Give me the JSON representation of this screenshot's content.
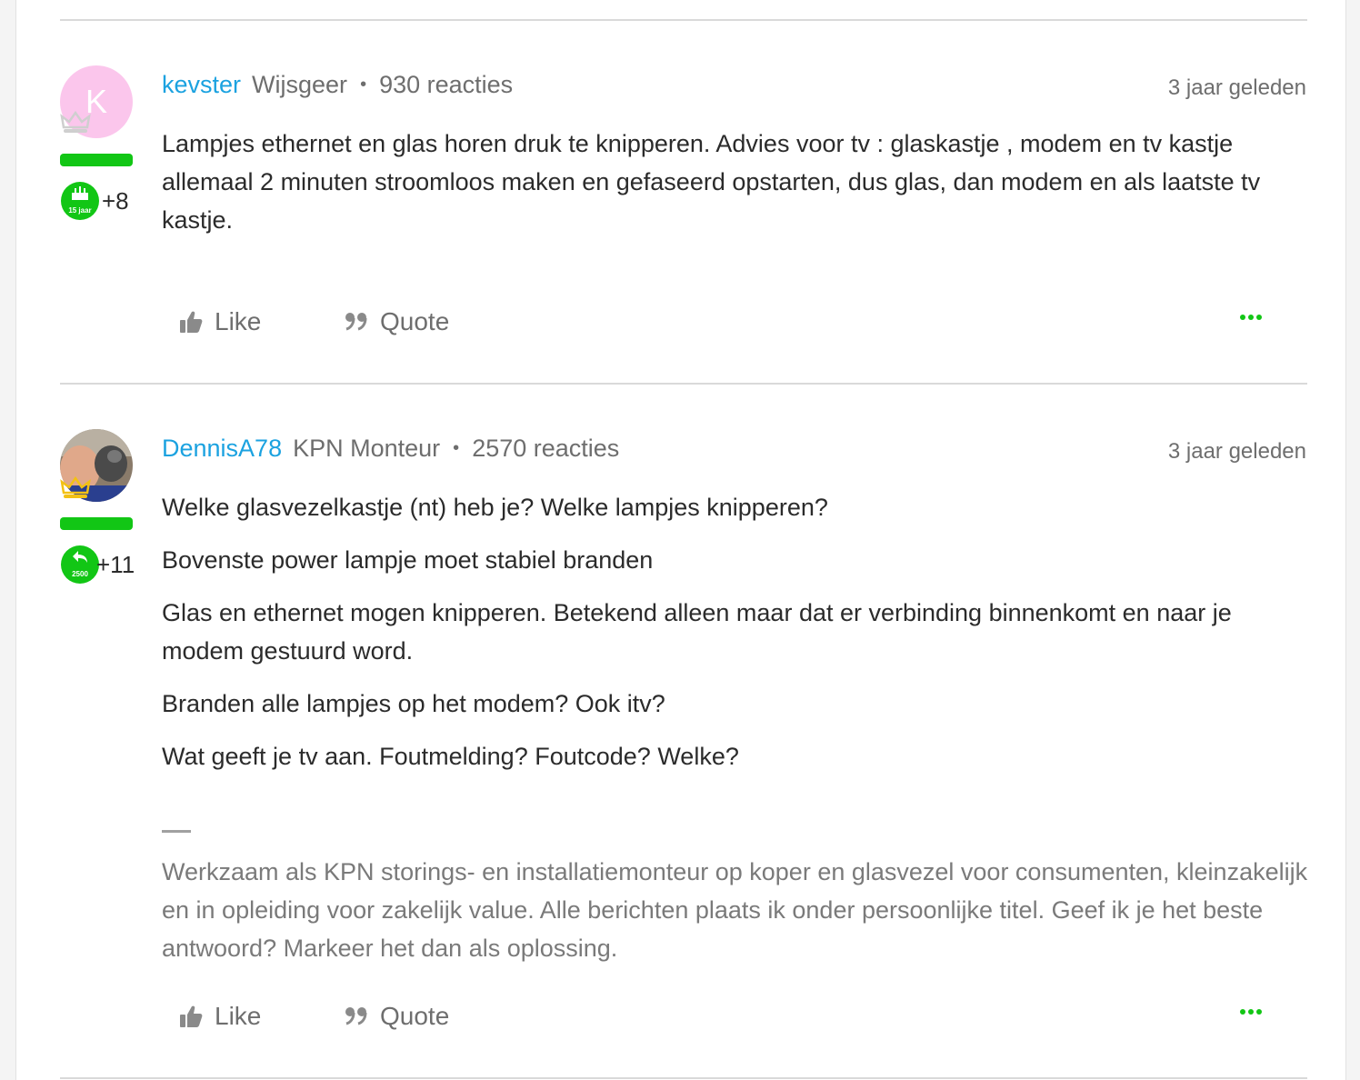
{
  "posts": [
    {
      "avatar_initial": "K",
      "username": "kevster",
      "role": "Wijsgeer",
      "separator": "•",
      "reactions": "930 reacties",
      "timestamp": "3 jaar geleden",
      "badge_text": "15 jaar",
      "badge_count": "+8",
      "body": [
        "Lampjes ethernet en glas horen druk te knipperen. Advies voor tv : glaskastje , modem en tv kastje allemaal 2 minuten stroomloos maken en gefaseerd opstarten,  dus glas, dan modem en als laatste tv kastje."
      ],
      "like_label": "Like",
      "quote_label": "Quote"
    },
    {
      "username": "DennisA78",
      "role": "KPN Monteur",
      "separator": "•",
      "reactions": "2570 reacties",
      "timestamp": "3 jaar geleden",
      "badge_text": "2500",
      "badge_count": "+11",
      "body": [
        "Welke glasvezelkastje (nt) heb je? Welke lampjes knipperen?",
        "Bovenste power lampje moet stabiel branden",
        "Glas en ethernet mogen knipperen. Betekend alleen maar dat er verbinding binnenkomt en naar je modem gestuurd word.",
        "Branden alle lampjes op het modem? Ook itv?",
        "Wat geeft je tv aan. Foutmelding? Foutcode? Welke?"
      ],
      "signature": "Werkzaam als KPN storings- en installatiemonteur op koper en glasvezel voor consumenten, kleinzakelijk en in opleiding voor zakelijk value. Alle berichten plaats ik onder persoonlijke titel. Geef ik je het beste antwoord? Markeer het dan als oplossing.",
      "like_label": "Like",
      "quote_label": "Quote"
    }
  ],
  "colors": {
    "accent_green": "#12c615",
    "username_blue": "#1ba2e0",
    "avatar_pink": "#fbc6ec"
  },
  "icons": [
    "thumbs-up-icon",
    "quote-icon",
    "more-dots-icon",
    "crown-icon",
    "anniversary-badge-icon",
    "reply-badge-icon"
  ]
}
